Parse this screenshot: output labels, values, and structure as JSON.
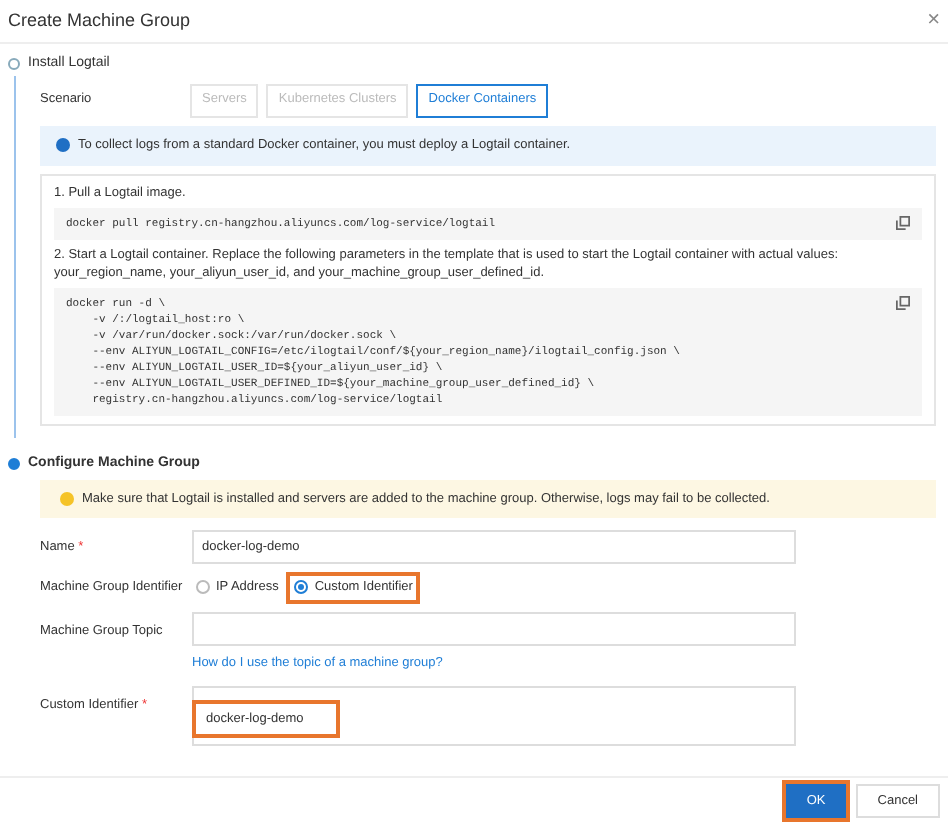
{
  "dialog": {
    "title": "Create Machine Group",
    "close": "×"
  },
  "steps": [
    {
      "title": "Install Logtail",
      "selected": false
    },
    {
      "title": "Configure Machine Group",
      "selected": true
    }
  ],
  "scenario": {
    "label": "Scenario",
    "options": [
      {
        "label": "Servers",
        "selected": false,
        "disabled": true
      },
      {
        "label": "Kubernetes Clusters",
        "selected": false,
        "disabled": true
      },
      {
        "label": "Docker Containers",
        "selected": true,
        "disabled": false
      }
    ]
  },
  "info": "To collect logs from a standard Docker container, you must deploy a Logtail container.",
  "instructions": [
    {
      "text": "1. Pull a Logtail image.",
      "code": [
        "docker pull registry.cn-hangzhou.aliyuncs.com/log-service/logtail"
      ]
    },
    {
      "text": "2. Start a Logtail container. Replace the following parameters in the template that is used to start the Logtail container with actual values: your_region_name, your_aliyun_user_id, and your_machine_group_user_defined_id.",
      "code": [
        "docker run -d \\",
        "    -v /:/logtail_host:ro \\",
        "    -v /var/run/docker.sock:/var/run/docker.sock \\",
        "    --env ALIYUN_LOGTAIL_CONFIG=/etc/ilogtail/conf/${your_region_name}/ilogtail_config.json \\",
        "    --env ALIYUN_LOGTAIL_USER_ID=${your_aliyun_user_id} \\",
        "    --env ALIYUN_LOGTAIL_USER_DEFINED_ID=${your_machine_group_user_defined_id} \\",
        "    registry.cn-hangzhou.aliyuncs.com/log-service/logtail"
      ]
    }
  ],
  "warning": "Make sure that Logtail is installed and servers are added to the machine group. Otherwise, logs may fail to be collected.",
  "form": {
    "name": {
      "label": "Name",
      "required": "*",
      "value": "docker-log-demo"
    },
    "identifier": {
      "label": "Machine Group Identifier",
      "options": [
        {
          "label": "IP Address",
          "selected": false,
          "highlighted": false
        },
        {
          "label": "Custom Identifier",
          "selected": true,
          "highlighted": true
        }
      ]
    },
    "topic": {
      "label": "Machine Group Topic",
      "link": "How do I use the topic of a machine group?"
    },
    "custom": {
      "label": "Custom Identifier",
      "required": "*",
      "value": "docker-log-demo",
      "highlighted": true
    }
  },
  "buttons": [
    {
      "label": "OK",
      "kind": "primary",
      "highlighted": true
    },
    {
      "label": "Cancel",
      "kind": "secondary",
      "highlighted": false
    }
  ]
}
